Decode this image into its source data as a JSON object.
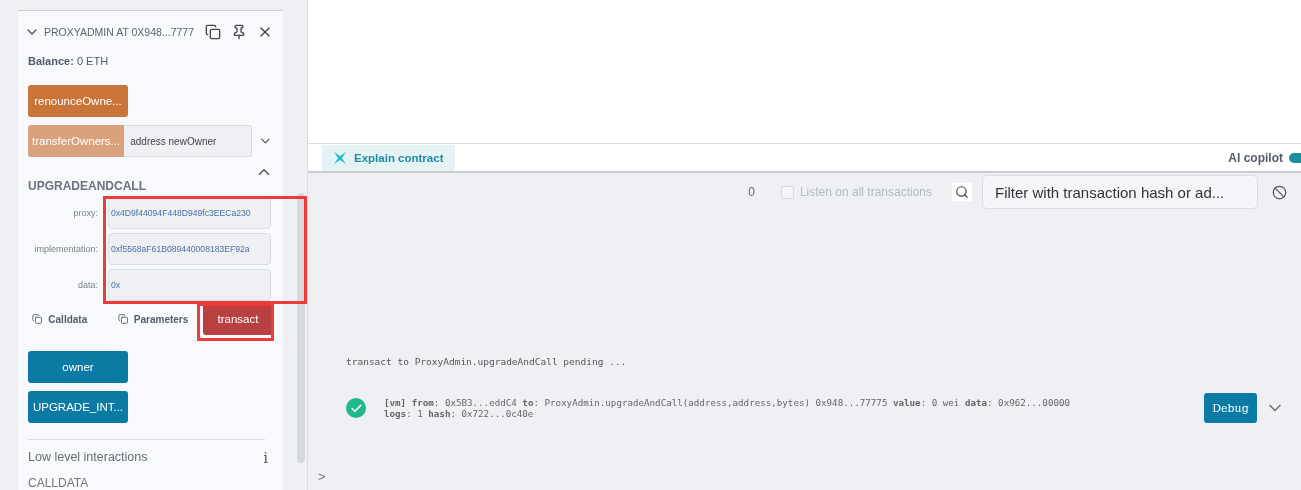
{
  "contract": {
    "title": "PROXYADMIN AT 0X948...7777",
    "balance_label": "Balance:",
    "balance_value": "0 ETH",
    "functions": [
      {
        "kind": "call",
        "label": "renounceOwne..."
      },
      {
        "kind": "input",
        "label": "transferOwners...",
        "placeholder": "address newOwner"
      }
    ],
    "expanded": {
      "name": "UPGRADEANDCALL",
      "params": [
        {
          "label": "proxy:",
          "value": "0x4D9f44094F448D949fc3EECa230"
        },
        {
          "label": "implementation:",
          "value": "0xf5568aF61B089440008183EF92a"
        },
        {
          "label": "data:",
          "value": "0x"
        }
      ],
      "copy_calldata": "Calldata",
      "copy_parameters": "Parameters",
      "submit": "transact"
    },
    "views": [
      {
        "label": "owner"
      },
      {
        "label": "UPGRADE_INT..."
      }
    ],
    "low_level": "Low level interactions",
    "info": "i",
    "calldata": "CALLDATA"
  },
  "tab_bar": {
    "explain": "Explain contract",
    "copilot": "AI copilot",
    "copilot_on": true
  },
  "terminal": {
    "count": "0",
    "listen": {
      "label": "Listen on all transactions",
      "checked": false,
      "disabled": true
    },
    "filter_placeholder": "Filter with transaction hash or ad...",
    "pending": "transact to ProxyAdmin.upgradeAndCall pending ...",
    "logs": [
      {
        "lines": [
          "**[vm]** **from**: 0x5B3...eddC4 **to**: ProxyAdmin.upgradeAndCall(address,address,bytes) 0x948...77775 **value**: 0 wei **data**: 0x962...00000",
          "**logs**: 1 **hash**: 0x722...0c40e"
        ],
        "button": "Debug"
      }
    ],
    "prompt": ">"
  }
}
